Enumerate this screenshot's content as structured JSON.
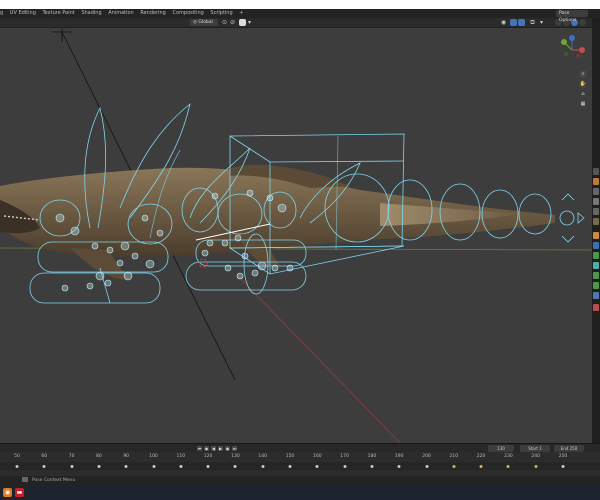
{
  "menu": {
    "items": [
      "g",
      "UV Editing",
      "Texture Paint",
      "Shading",
      "Animation",
      "Rendering",
      "Compositing",
      "Scripting",
      "+"
    ]
  },
  "header": {
    "transform_orientation": "Global",
    "pose_options": "Pose Options"
  },
  "navigation": {
    "gizmo_axes": [
      "X",
      "Y",
      "Z"
    ]
  },
  "timeline": {
    "current_frame": "130",
    "start_label": "Start",
    "start_value": "1",
    "end_label": "End",
    "end_value": "250",
    "ticks": [
      {
        "label": "50",
        "key": false
      },
      {
        "label": "60",
        "key": false
      },
      {
        "label": "70",
        "key": false
      },
      {
        "label": "80",
        "key": false
      },
      {
        "label": "90",
        "key": false
      },
      {
        "label": "100",
        "key": false
      },
      {
        "label": "110",
        "key": false
      },
      {
        "label": "120",
        "key": false
      },
      {
        "label": "130",
        "key": false
      },
      {
        "label": "140",
        "key": false
      },
      {
        "label": "150",
        "key": false
      },
      {
        "label": "160",
        "key": false
      },
      {
        "label": "170",
        "key": false
      },
      {
        "label": "180",
        "key": false
      },
      {
        "label": "190",
        "key": false
      },
      {
        "label": "200",
        "key": false
      },
      {
        "label": "210",
        "key": true
      },
      {
        "label": "220",
        "key": true
      },
      {
        "label": "230",
        "key": true
      },
      {
        "label": "240",
        "key": true
      },
      {
        "label": "250",
        "key": false
      }
    ]
  },
  "status_bar": {
    "text": "Pose Context Menu"
  },
  "colors": {
    "accent": "#4772b3",
    "rig": "#7fd6ee",
    "keyframe_selected": "#d6b83a"
  }
}
